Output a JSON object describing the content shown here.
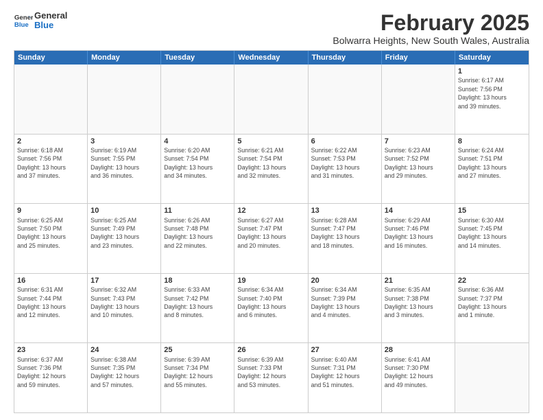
{
  "logo": {
    "line1": "General",
    "line2": "Blue"
  },
  "title": "February 2025",
  "subtitle": "Bolwarra Heights, New South Wales, Australia",
  "header_days": [
    "Sunday",
    "Monday",
    "Tuesday",
    "Wednesday",
    "Thursday",
    "Friday",
    "Saturday"
  ],
  "weeks": [
    [
      {
        "day": "",
        "info": ""
      },
      {
        "day": "",
        "info": ""
      },
      {
        "day": "",
        "info": ""
      },
      {
        "day": "",
        "info": ""
      },
      {
        "day": "",
        "info": ""
      },
      {
        "day": "",
        "info": ""
      },
      {
        "day": "1",
        "info": "Sunrise: 6:17 AM\nSunset: 7:56 PM\nDaylight: 13 hours\nand 39 minutes."
      }
    ],
    [
      {
        "day": "2",
        "info": "Sunrise: 6:18 AM\nSunset: 7:56 PM\nDaylight: 13 hours\nand 37 minutes."
      },
      {
        "day": "3",
        "info": "Sunrise: 6:19 AM\nSunset: 7:55 PM\nDaylight: 13 hours\nand 36 minutes."
      },
      {
        "day": "4",
        "info": "Sunrise: 6:20 AM\nSunset: 7:54 PM\nDaylight: 13 hours\nand 34 minutes."
      },
      {
        "day": "5",
        "info": "Sunrise: 6:21 AM\nSunset: 7:54 PM\nDaylight: 13 hours\nand 32 minutes."
      },
      {
        "day": "6",
        "info": "Sunrise: 6:22 AM\nSunset: 7:53 PM\nDaylight: 13 hours\nand 31 minutes."
      },
      {
        "day": "7",
        "info": "Sunrise: 6:23 AM\nSunset: 7:52 PM\nDaylight: 13 hours\nand 29 minutes."
      },
      {
        "day": "8",
        "info": "Sunrise: 6:24 AM\nSunset: 7:51 PM\nDaylight: 13 hours\nand 27 minutes."
      }
    ],
    [
      {
        "day": "9",
        "info": "Sunrise: 6:25 AM\nSunset: 7:50 PM\nDaylight: 13 hours\nand 25 minutes."
      },
      {
        "day": "10",
        "info": "Sunrise: 6:25 AM\nSunset: 7:49 PM\nDaylight: 13 hours\nand 23 minutes."
      },
      {
        "day": "11",
        "info": "Sunrise: 6:26 AM\nSunset: 7:48 PM\nDaylight: 13 hours\nand 22 minutes."
      },
      {
        "day": "12",
        "info": "Sunrise: 6:27 AM\nSunset: 7:47 PM\nDaylight: 13 hours\nand 20 minutes."
      },
      {
        "day": "13",
        "info": "Sunrise: 6:28 AM\nSunset: 7:47 PM\nDaylight: 13 hours\nand 18 minutes."
      },
      {
        "day": "14",
        "info": "Sunrise: 6:29 AM\nSunset: 7:46 PM\nDaylight: 13 hours\nand 16 minutes."
      },
      {
        "day": "15",
        "info": "Sunrise: 6:30 AM\nSunset: 7:45 PM\nDaylight: 13 hours\nand 14 minutes."
      }
    ],
    [
      {
        "day": "16",
        "info": "Sunrise: 6:31 AM\nSunset: 7:44 PM\nDaylight: 13 hours\nand 12 minutes."
      },
      {
        "day": "17",
        "info": "Sunrise: 6:32 AM\nSunset: 7:43 PM\nDaylight: 13 hours\nand 10 minutes."
      },
      {
        "day": "18",
        "info": "Sunrise: 6:33 AM\nSunset: 7:42 PM\nDaylight: 13 hours\nand 8 minutes."
      },
      {
        "day": "19",
        "info": "Sunrise: 6:34 AM\nSunset: 7:40 PM\nDaylight: 13 hours\nand 6 minutes."
      },
      {
        "day": "20",
        "info": "Sunrise: 6:34 AM\nSunset: 7:39 PM\nDaylight: 13 hours\nand 4 minutes."
      },
      {
        "day": "21",
        "info": "Sunrise: 6:35 AM\nSunset: 7:38 PM\nDaylight: 13 hours\nand 3 minutes."
      },
      {
        "day": "22",
        "info": "Sunrise: 6:36 AM\nSunset: 7:37 PM\nDaylight: 13 hours\nand 1 minute."
      }
    ],
    [
      {
        "day": "23",
        "info": "Sunrise: 6:37 AM\nSunset: 7:36 PM\nDaylight: 12 hours\nand 59 minutes."
      },
      {
        "day": "24",
        "info": "Sunrise: 6:38 AM\nSunset: 7:35 PM\nDaylight: 12 hours\nand 57 minutes."
      },
      {
        "day": "25",
        "info": "Sunrise: 6:39 AM\nSunset: 7:34 PM\nDaylight: 12 hours\nand 55 minutes."
      },
      {
        "day": "26",
        "info": "Sunrise: 6:39 AM\nSunset: 7:33 PM\nDaylight: 12 hours\nand 53 minutes."
      },
      {
        "day": "27",
        "info": "Sunrise: 6:40 AM\nSunset: 7:31 PM\nDaylight: 12 hours\nand 51 minutes."
      },
      {
        "day": "28",
        "info": "Sunrise: 6:41 AM\nSunset: 7:30 PM\nDaylight: 12 hours\nand 49 minutes."
      },
      {
        "day": "",
        "info": ""
      }
    ]
  ]
}
